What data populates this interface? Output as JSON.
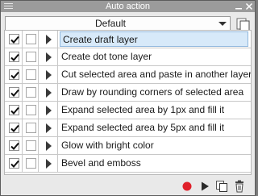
{
  "panel": {
    "title": "Auto action"
  },
  "set_selector": {
    "value": "Default"
  },
  "actions": [
    {
      "label": "Create draft layer",
      "enabled": true,
      "selected": true
    },
    {
      "label": "Create dot tone layer",
      "enabled": true,
      "selected": false
    },
    {
      "label": "Cut selected area and paste in another layer",
      "enabled": true,
      "selected": false
    },
    {
      "label": "Draw by rounding corners of selected area",
      "enabled": true,
      "selected": false
    },
    {
      "label": "Expand selected area by 1px and fill it",
      "enabled": true,
      "selected": false
    },
    {
      "label": "Expand selected area by 5px and fill it",
      "enabled": true,
      "selected": false
    },
    {
      "label": "Glow with bright color",
      "enabled": true,
      "selected": false
    },
    {
      "label": "Bevel and emboss",
      "enabled": true,
      "selected": false
    }
  ],
  "toolbar": {
    "icons": [
      "record-icon",
      "play-icon",
      "duplicate-icon",
      "trash-icon"
    ]
  },
  "colors": {
    "record": "#e0202a",
    "selection_bg": "#d7e9f9",
    "selection_border": "#8fb6dc",
    "title_bar": "#9b9b9b"
  }
}
